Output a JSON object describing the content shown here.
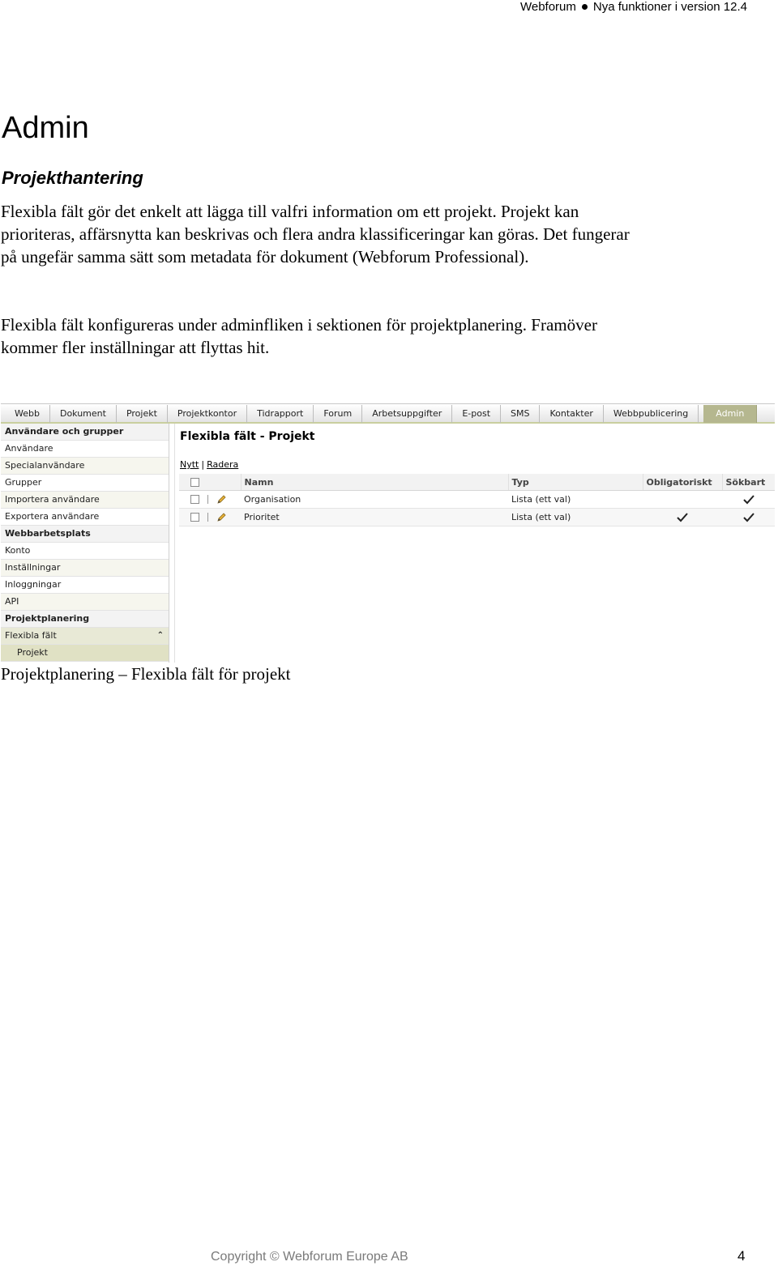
{
  "header": {
    "product": "Webforum",
    "subtitle": "Nya funktioner i version 12.4"
  },
  "heading": "Admin",
  "subheading": "Projekthantering",
  "paragraphs": [
    "Flexibla fält gör det enkelt att lägga till valfri information om ett projekt. Projekt kan prioriteras, affärsnytta kan beskrivas och flera andra klassificeringar kan göras. Det fungerar på ungefär samma sätt som metadata för dokument (Webforum Professional).",
    "Flexibla fält konfigureras under adminfliken i sektionen för projektplanering. Framöver kommer fler inställningar att flyttas hit."
  ],
  "screenshot": {
    "tabs": [
      "Webb",
      "Dokument",
      "Projekt",
      "Projektkontor",
      "Tidrapport",
      "Forum",
      "Arbetsuppgifter",
      "E-post",
      "SMS",
      "Kontakter",
      "Webbpublicering",
      "Admin"
    ],
    "active_tab": "Admin",
    "sidebar": [
      {
        "label": "Användare och grupper"
      },
      {
        "label": "Användare"
      },
      {
        "label": "Specialanvändare"
      },
      {
        "label": "Grupper"
      },
      {
        "label": "Importera användare"
      },
      {
        "label": "Exportera användare"
      },
      {
        "label": "Webbarbetsplats"
      },
      {
        "label": "Konto"
      },
      {
        "label": "Inställningar"
      },
      {
        "label": "Inloggningar"
      },
      {
        "label": "API"
      },
      {
        "label": "Projektplanering"
      },
      {
        "label": "Flexibla fält"
      },
      {
        "label": "Projekt"
      }
    ],
    "title": "Flexibla fält - Projekt",
    "actions": {
      "new": "Nytt",
      "separator": "|",
      "delete": "Radera"
    },
    "columns": {
      "name": "Namn",
      "type": "Typ",
      "required": "Obligatoriskt",
      "searchable": "Sökbart"
    },
    "rows": [
      {
        "name": "Organisation",
        "type": "Lista (ett val)",
        "required": false,
        "searchable": true
      },
      {
        "name": "Prioritet",
        "type": "Lista (ett val)",
        "required": true,
        "searchable": true
      }
    ]
  },
  "caption": "Projektplanering – Flexibla fält för projekt",
  "footer": {
    "copyright": "Copyright © Webforum Europe AB",
    "page_number": "4"
  }
}
